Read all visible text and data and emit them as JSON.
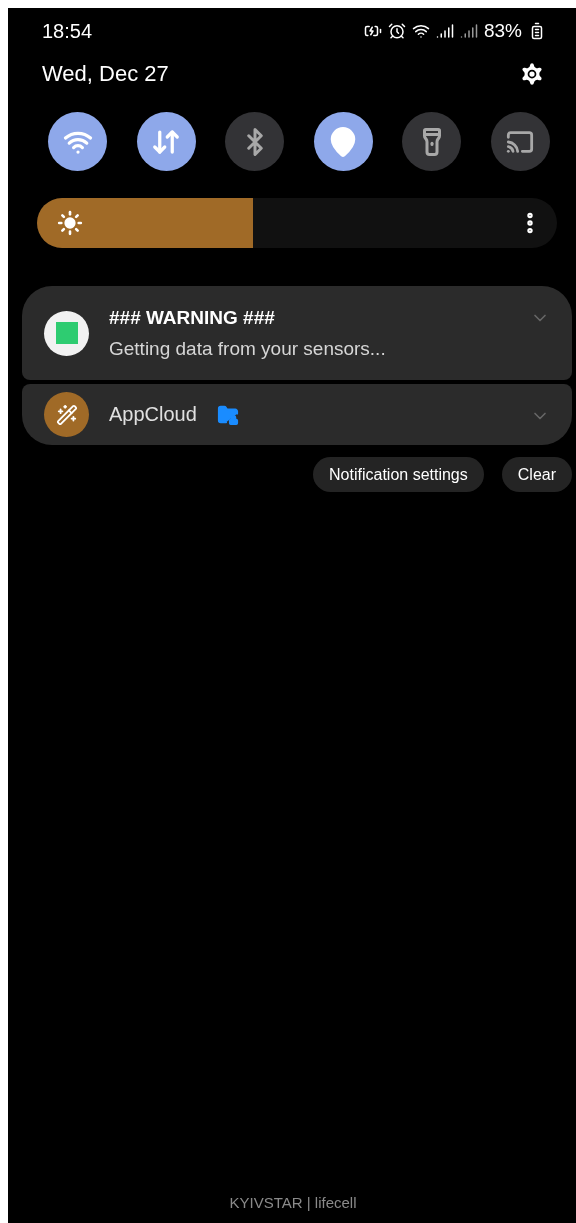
{
  "status_bar": {
    "time": "18:54",
    "battery_percent": "83%"
  },
  "header": {
    "date": "Wed, Dec 27"
  },
  "quick_toggles": [
    {
      "kind": "wifi",
      "on": true
    },
    {
      "kind": "data",
      "on": true
    },
    {
      "kind": "bluetooth",
      "on": false
    },
    {
      "kind": "location",
      "on": true
    },
    {
      "kind": "flashlight",
      "on": false
    },
    {
      "kind": "cast",
      "on": false
    }
  ],
  "brightness": {
    "level": 0.415
  },
  "notifications": [
    {
      "kind": "sensor",
      "title": "### WARNING ###",
      "text": "Getting data from your sensors..."
    },
    {
      "kind": "appcloud",
      "title": "AppCloud"
    }
  ],
  "actions": [
    "Notification settings",
    "Clear"
  ],
  "carrier": "KYIVSTAR | lifecell"
}
